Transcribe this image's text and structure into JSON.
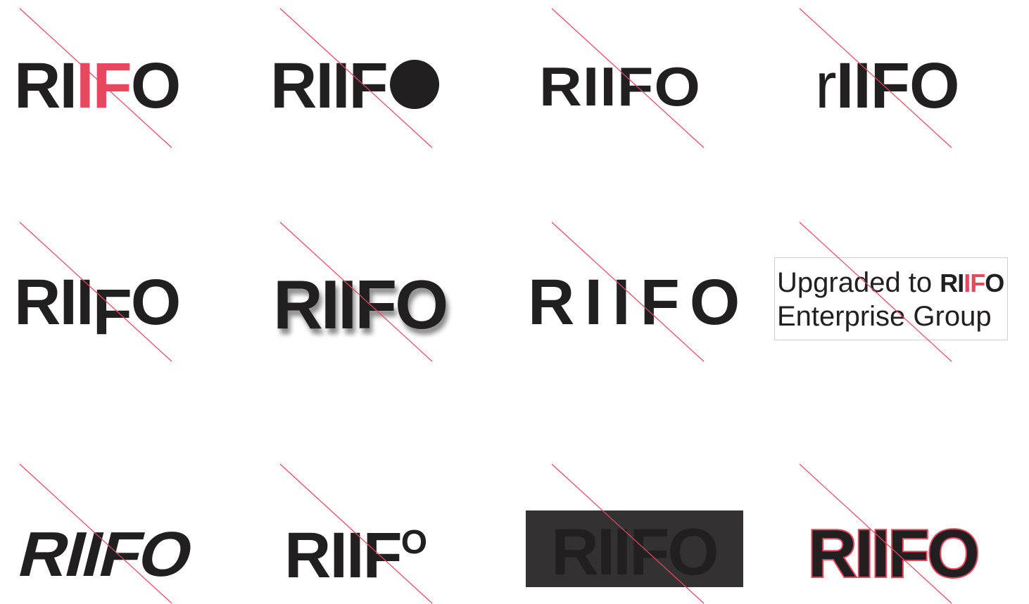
{
  "logos": {
    "c1": {
      "parts": [
        "RI",
        "IF",
        "O"
      ]
    },
    "c2": {
      "parts": [
        "RIIF"
      ]
    },
    "c3": {
      "parts": [
        "RIIFO"
      ]
    },
    "c4": {
      "parts": [
        "r",
        "IIFO"
      ]
    },
    "c5": {
      "parts": [
        "RII",
        "F",
        "O"
      ]
    },
    "c6": {
      "parts": [
        "RIIFO"
      ]
    },
    "c7": {
      "parts": [
        "RIIFO"
      ]
    },
    "c8": {
      "line1": "Upgraded to ",
      "mini_parts": [
        "RI",
        "IF",
        "O"
      ],
      "line2": "Enterprise Group"
    },
    "c9": {
      "parts": [
        "RIIFO"
      ]
    },
    "c10": {
      "parts": [
        "RIIF",
        "O"
      ]
    },
    "c11": {
      "parts": [
        "RIIFO"
      ]
    },
    "c12": {
      "parts": [
        "RIIFO"
      ]
    }
  },
  "colors": {
    "brand_dark": "#221f20",
    "brand_red": "#e8485f",
    "strike_line": "#e8485f",
    "dark_box": "#333132"
  }
}
